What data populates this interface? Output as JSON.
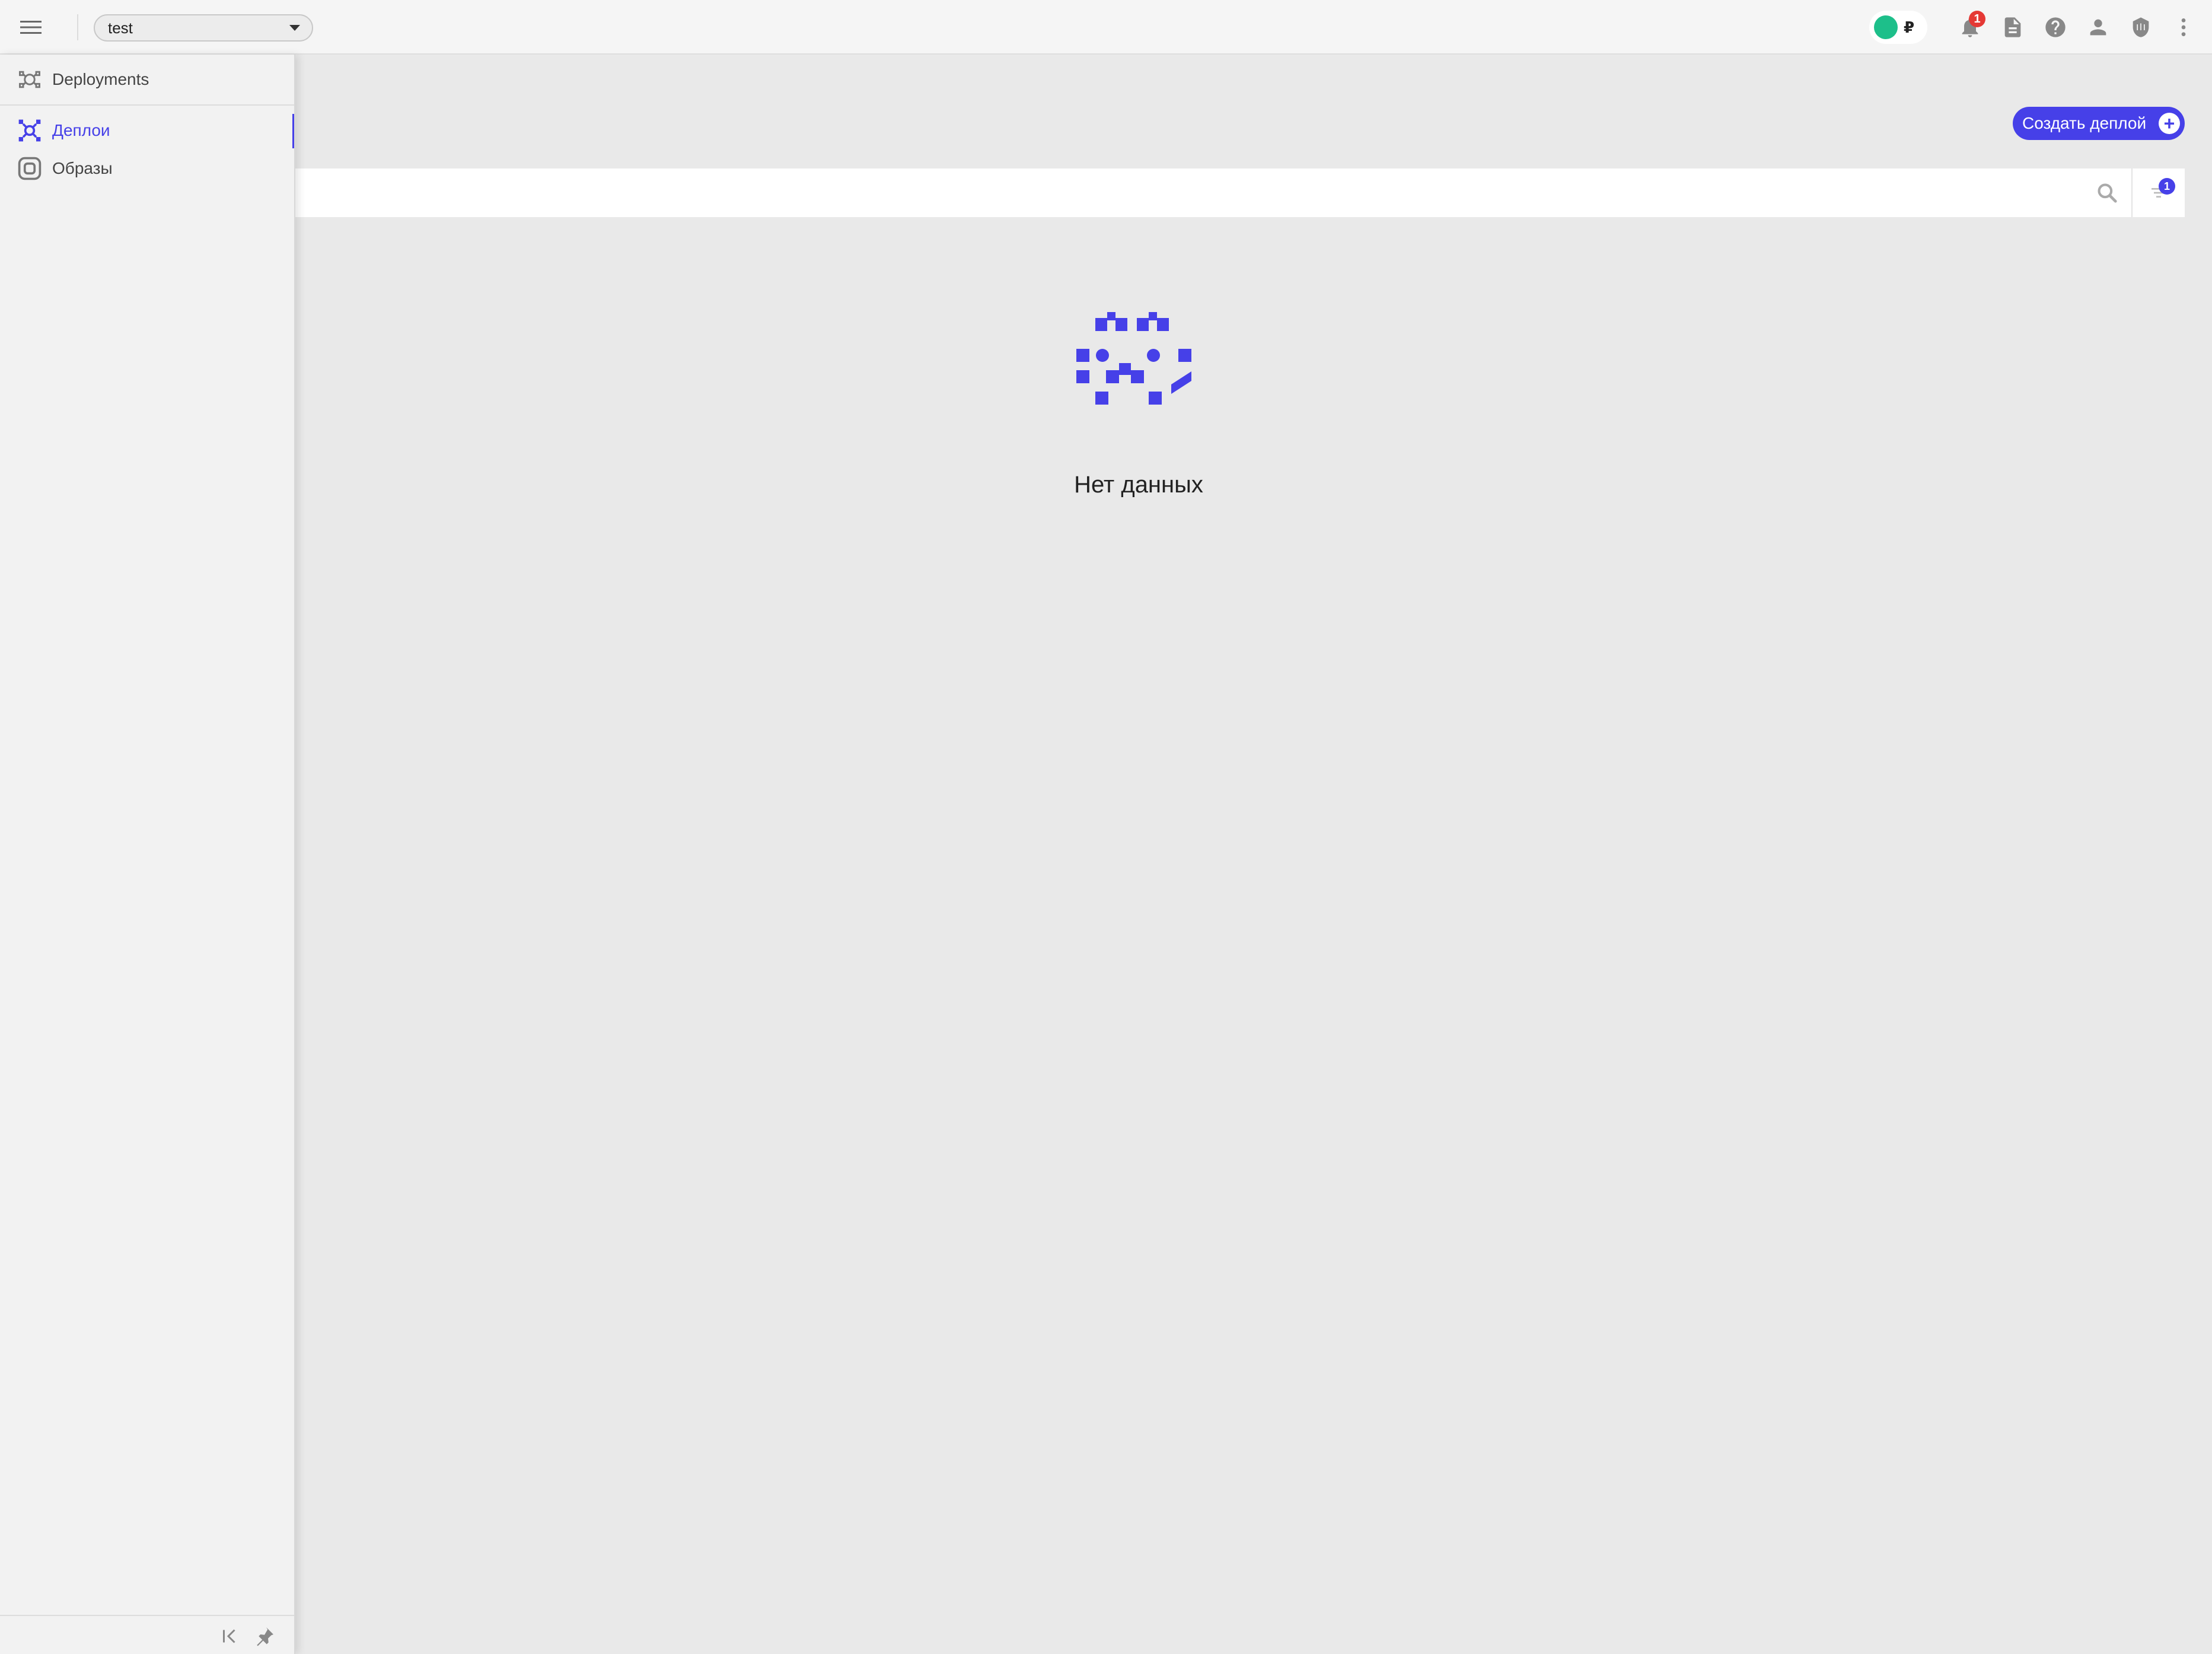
{
  "topbar": {
    "project_select": {
      "value": "test"
    },
    "balance": {
      "currency_symbol": "₽",
      "status_color": "#1dbf8a"
    },
    "notifications": {
      "count": "1"
    },
    "icons": [
      "menu-icon",
      "bell-icon",
      "document-icon",
      "help-icon",
      "user-icon",
      "shield-icon",
      "more-vertical-icon"
    ]
  },
  "sidebar": {
    "header": {
      "label": "Deployments",
      "icon": "deployments-icon"
    },
    "items": [
      {
        "label": "Деплои",
        "icon": "deploys-icon",
        "active": true
      },
      {
        "label": "Образы",
        "icon": "images-icon",
        "active": false
      }
    ],
    "footer": {
      "icons": [
        "collapse-icon",
        "pin-icon"
      ]
    }
  },
  "main": {
    "create_button": {
      "label": "Создать деплой"
    },
    "search": {
      "value": "",
      "placeholder": ""
    },
    "filter": {
      "count": "1"
    },
    "empty_state": {
      "text": "Нет данных"
    }
  },
  "colors": {
    "accent": "#4640e8",
    "notification_badge": "#e53935",
    "background": "#e9e9e9"
  }
}
